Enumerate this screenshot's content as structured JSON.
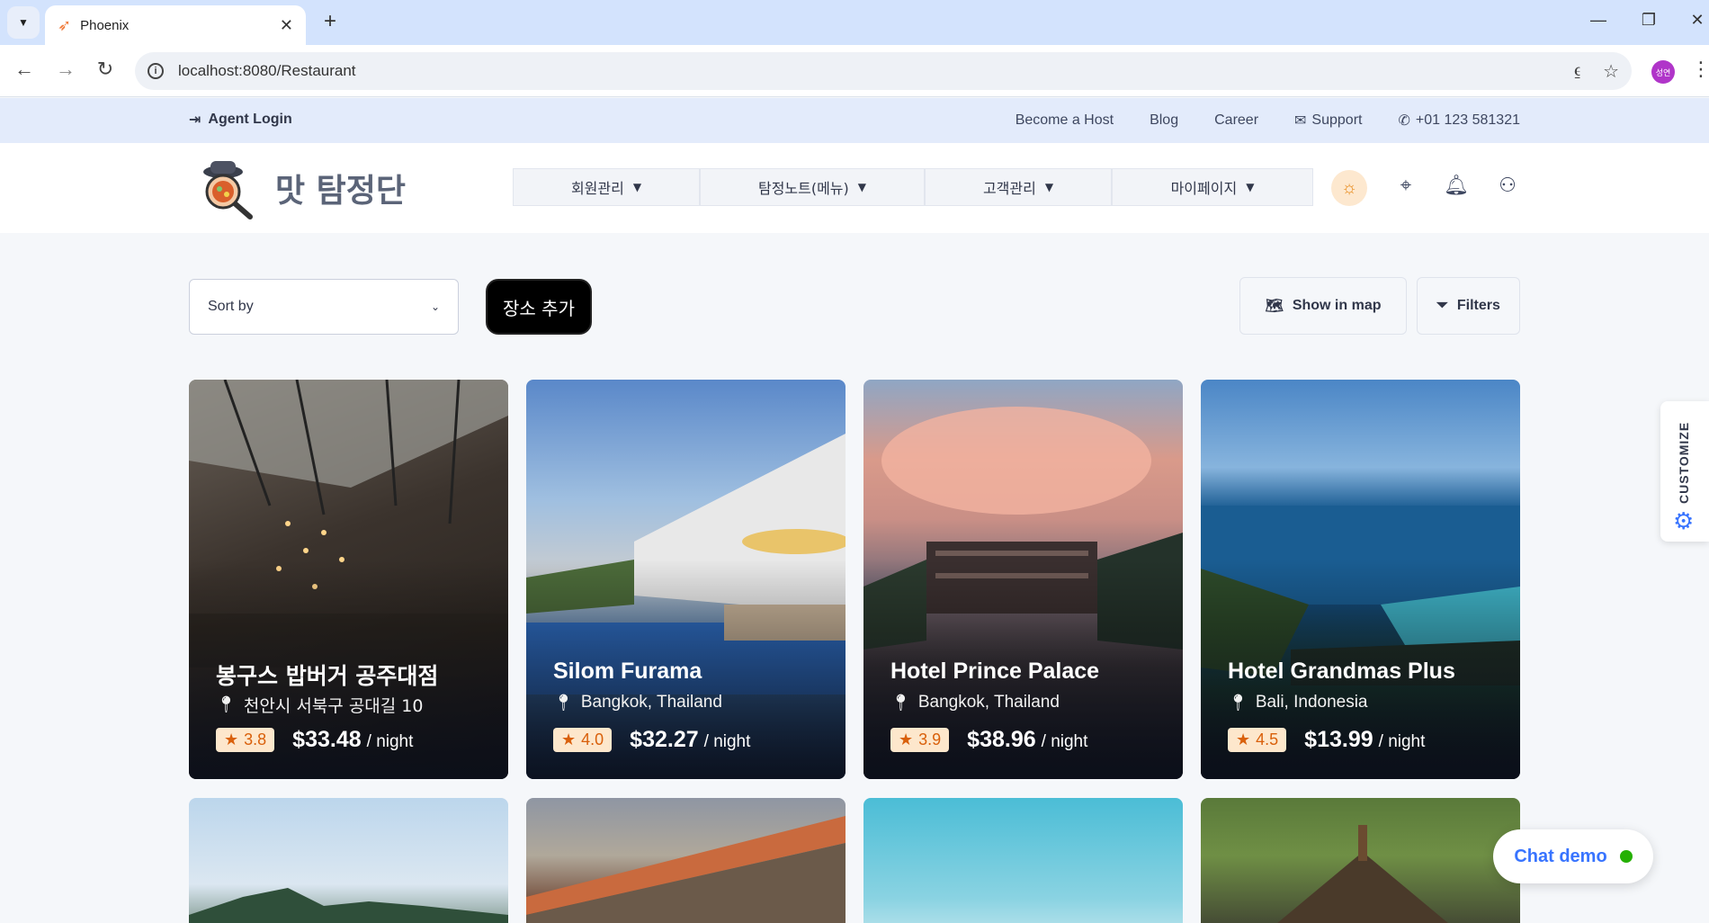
{
  "browser": {
    "tab_title": "Phoenix",
    "url": "localhost:8080/Restaurant",
    "profile_initials": "성연"
  },
  "topbar": {
    "agent_login": "Agent Login",
    "links": [
      "Become a Host",
      "Blog",
      "Career",
      "Support",
      "+01 123 581321"
    ]
  },
  "navbar": {
    "brand": "맛 탐정단",
    "menu": [
      "회원관리",
      "탐정노트(메뉴)",
      "고객관리",
      "마이페이지"
    ]
  },
  "controls": {
    "sort_by": "Sort by",
    "add_place": "장소 추가",
    "show_in_map": "Show in map",
    "filters": "Filters"
  },
  "cards": [
    {
      "name": "봉구스 밥버거 공주대점",
      "location": "천안시 서북구 공대길 10",
      "rating": "3.8",
      "price": "$33.48",
      "unit": "/ night"
    },
    {
      "name": "Silom Furama",
      "location": "Bangkok, Thailand",
      "rating": "4.0",
      "price": "$32.27",
      "unit": "/ night"
    },
    {
      "name": "Hotel Prince Palace",
      "location": "Bangkok, Thailand",
      "rating": "3.9",
      "price": "$38.96",
      "unit": "/ night"
    },
    {
      "name": "Hotel Grandmas Plus",
      "location": "Bali, Indonesia",
      "rating": "4.5",
      "price": "$13.99",
      "unit": "/ night"
    }
  ],
  "widgets": {
    "customize": "CUSTOMIZE",
    "chat_demo": "Chat demo"
  },
  "colors": {
    "accent": "#3874ff",
    "rating_bg": "#fde7cc",
    "rating_text": "#d9600b",
    "topbar_bg": "#e3ebfb",
    "online": "#25b003"
  }
}
